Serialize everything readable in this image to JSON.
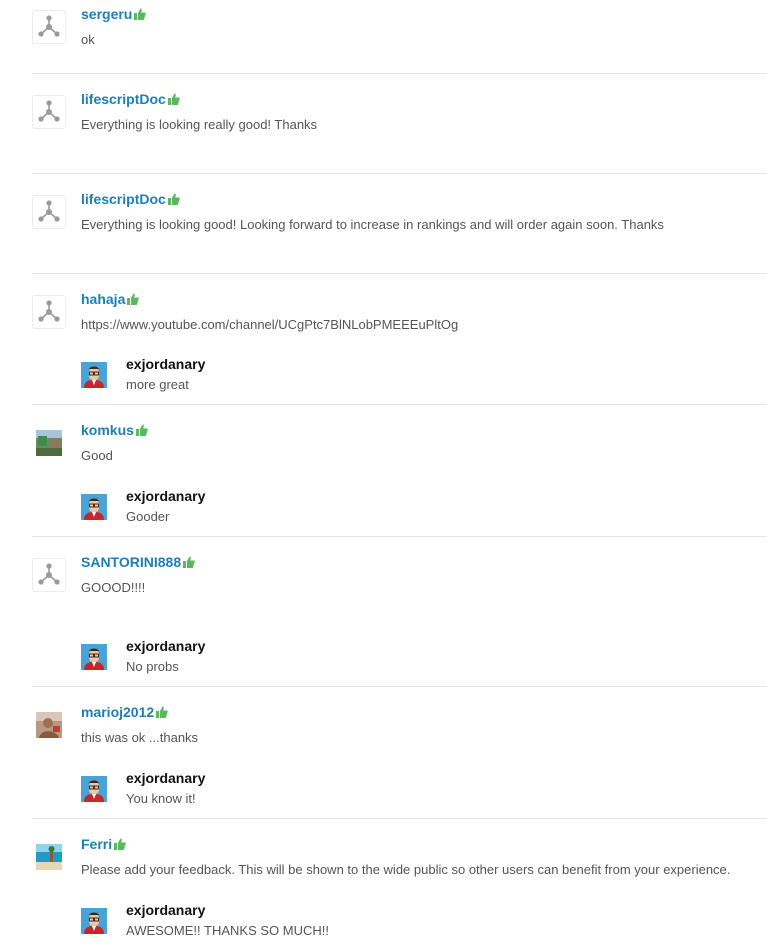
{
  "reviews": [
    {
      "username": "sergeru",
      "comment": "ok",
      "avatar": "default-molecule-avatar"
    },
    {
      "username": "lifescriptDoc",
      "comment": "Everything is looking really good! Thanks",
      "avatar": "default-molecule-avatar"
    },
    {
      "username": "lifescriptDoc",
      "comment": "Everything is looking good! Looking forward to increase in rankings and will order again soon. Thanks",
      "avatar": "default-molecule-avatar"
    },
    {
      "username": "hahaja",
      "comment": "https://www.youtube.com/channel/UCgPtc7BlNLobPMEEEuPltOg",
      "avatar": "default-molecule-avatar",
      "reply": {
        "username": "exjordanary",
        "text": "more great"
      }
    },
    {
      "username": "komkus",
      "comment": "Good",
      "avatar": "landscape-photo-avatar",
      "reply": {
        "username": "exjordanary",
        "text": "Gooder"
      }
    },
    {
      "username": "SANTORINI888",
      "comment": "GOOOD!!!!",
      "avatar": "default-molecule-avatar",
      "reply": {
        "username": "exjordanary",
        "text": "No probs"
      }
    },
    {
      "username": "marioj2012",
      "comment": "this was ok ...thanks",
      "avatar": "person-photo-avatar",
      "reply": {
        "username": "exjordanary",
        "text": "You know it!"
      }
    },
    {
      "username": "Ferri",
      "comment": "Please add your feedback. This will be shown to the wide public so other users can benefit from your experience.",
      "avatar": "beach-photo-avatar",
      "reply": {
        "username": "exjordanary",
        "text": "AWESOME!! THANKS SO MUCH!!"
      }
    }
  ],
  "colors": {
    "username": "#1d7fb5",
    "thumbs_up": "#5cb85c",
    "divider": "#e6e6e6",
    "comment_text": "#555555"
  },
  "icons": {
    "positive_rating": "thumbs-up-icon"
  }
}
